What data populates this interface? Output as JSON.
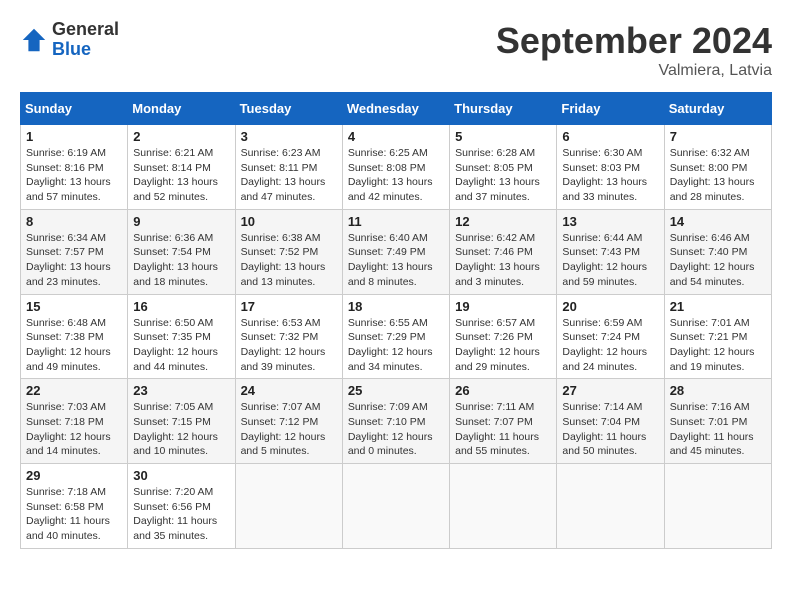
{
  "logo": {
    "general": "General",
    "blue": "Blue"
  },
  "title": "September 2024",
  "location": "Valmiera, Latvia",
  "days_header": [
    "Sunday",
    "Monday",
    "Tuesday",
    "Wednesday",
    "Thursday",
    "Friday",
    "Saturday"
  ],
  "weeks": [
    [
      {
        "day": "1",
        "info": "Sunrise: 6:19 AM\nSunset: 8:16 PM\nDaylight: 13 hours\nand 57 minutes."
      },
      {
        "day": "2",
        "info": "Sunrise: 6:21 AM\nSunset: 8:14 PM\nDaylight: 13 hours\nand 52 minutes."
      },
      {
        "day": "3",
        "info": "Sunrise: 6:23 AM\nSunset: 8:11 PM\nDaylight: 13 hours\nand 47 minutes."
      },
      {
        "day": "4",
        "info": "Sunrise: 6:25 AM\nSunset: 8:08 PM\nDaylight: 13 hours\nand 42 minutes."
      },
      {
        "day": "5",
        "info": "Sunrise: 6:28 AM\nSunset: 8:05 PM\nDaylight: 13 hours\nand 37 minutes."
      },
      {
        "day": "6",
        "info": "Sunrise: 6:30 AM\nSunset: 8:03 PM\nDaylight: 13 hours\nand 33 minutes."
      },
      {
        "day": "7",
        "info": "Sunrise: 6:32 AM\nSunset: 8:00 PM\nDaylight: 13 hours\nand 28 minutes."
      }
    ],
    [
      {
        "day": "8",
        "info": "Sunrise: 6:34 AM\nSunset: 7:57 PM\nDaylight: 13 hours\nand 23 minutes."
      },
      {
        "day": "9",
        "info": "Sunrise: 6:36 AM\nSunset: 7:54 PM\nDaylight: 13 hours\nand 18 minutes."
      },
      {
        "day": "10",
        "info": "Sunrise: 6:38 AM\nSunset: 7:52 PM\nDaylight: 13 hours\nand 13 minutes."
      },
      {
        "day": "11",
        "info": "Sunrise: 6:40 AM\nSunset: 7:49 PM\nDaylight: 13 hours\nand 8 minutes."
      },
      {
        "day": "12",
        "info": "Sunrise: 6:42 AM\nSunset: 7:46 PM\nDaylight: 13 hours\nand 3 minutes."
      },
      {
        "day": "13",
        "info": "Sunrise: 6:44 AM\nSunset: 7:43 PM\nDaylight: 12 hours\nand 59 minutes."
      },
      {
        "day": "14",
        "info": "Sunrise: 6:46 AM\nSunset: 7:40 PM\nDaylight: 12 hours\nand 54 minutes."
      }
    ],
    [
      {
        "day": "15",
        "info": "Sunrise: 6:48 AM\nSunset: 7:38 PM\nDaylight: 12 hours\nand 49 minutes."
      },
      {
        "day": "16",
        "info": "Sunrise: 6:50 AM\nSunset: 7:35 PM\nDaylight: 12 hours\nand 44 minutes."
      },
      {
        "day": "17",
        "info": "Sunrise: 6:53 AM\nSunset: 7:32 PM\nDaylight: 12 hours\nand 39 minutes."
      },
      {
        "day": "18",
        "info": "Sunrise: 6:55 AM\nSunset: 7:29 PM\nDaylight: 12 hours\nand 34 minutes."
      },
      {
        "day": "19",
        "info": "Sunrise: 6:57 AM\nSunset: 7:26 PM\nDaylight: 12 hours\nand 29 minutes."
      },
      {
        "day": "20",
        "info": "Sunrise: 6:59 AM\nSunset: 7:24 PM\nDaylight: 12 hours\nand 24 minutes."
      },
      {
        "day": "21",
        "info": "Sunrise: 7:01 AM\nSunset: 7:21 PM\nDaylight: 12 hours\nand 19 minutes."
      }
    ],
    [
      {
        "day": "22",
        "info": "Sunrise: 7:03 AM\nSunset: 7:18 PM\nDaylight: 12 hours\nand 14 minutes."
      },
      {
        "day": "23",
        "info": "Sunrise: 7:05 AM\nSunset: 7:15 PM\nDaylight: 12 hours\nand 10 minutes."
      },
      {
        "day": "24",
        "info": "Sunrise: 7:07 AM\nSunset: 7:12 PM\nDaylight: 12 hours\nand 5 minutes."
      },
      {
        "day": "25",
        "info": "Sunrise: 7:09 AM\nSunset: 7:10 PM\nDaylight: 12 hours\nand 0 minutes."
      },
      {
        "day": "26",
        "info": "Sunrise: 7:11 AM\nSunset: 7:07 PM\nDaylight: 11 hours\nand 55 minutes."
      },
      {
        "day": "27",
        "info": "Sunrise: 7:14 AM\nSunset: 7:04 PM\nDaylight: 11 hours\nand 50 minutes."
      },
      {
        "day": "28",
        "info": "Sunrise: 7:16 AM\nSunset: 7:01 PM\nDaylight: 11 hours\nand 45 minutes."
      }
    ],
    [
      {
        "day": "29",
        "info": "Sunrise: 7:18 AM\nSunset: 6:58 PM\nDaylight: 11 hours\nand 40 minutes."
      },
      {
        "day": "30",
        "info": "Sunrise: 7:20 AM\nSunset: 6:56 PM\nDaylight: 11 hours\nand 35 minutes."
      },
      {
        "day": "",
        "info": ""
      },
      {
        "day": "",
        "info": ""
      },
      {
        "day": "",
        "info": ""
      },
      {
        "day": "",
        "info": ""
      },
      {
        "day": "",
        "info": ""
      }
    ]
  ]
}
